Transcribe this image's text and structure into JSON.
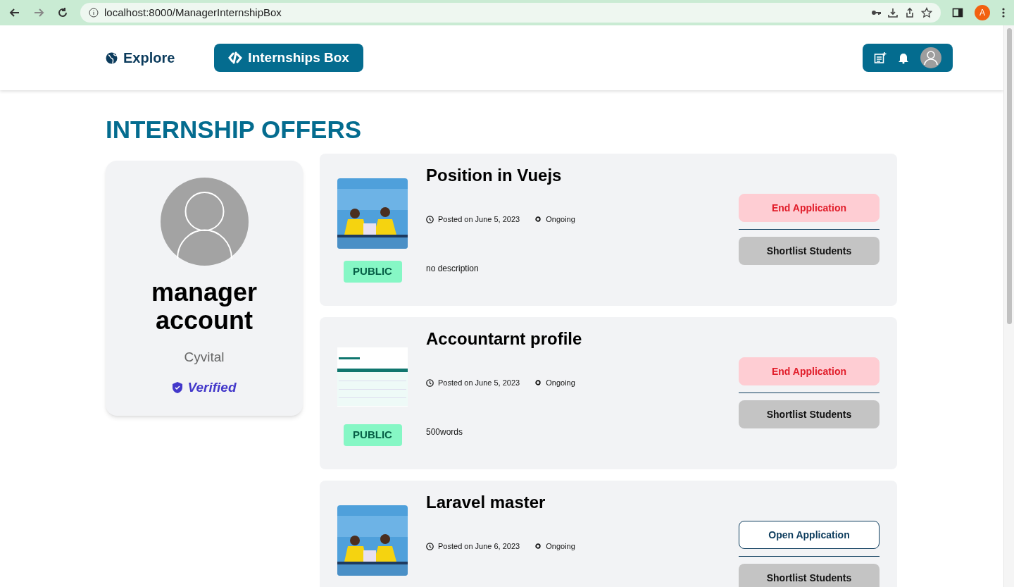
{
  "browser": {
    "url": "localhost:8000/ManagerInternshipBox",
    "profile_initial": "A"
  },
  "nav": {
    "explore": "Explore",
    "internships": "Internships Box"
  },
  "heading": "INTERNSHIP OFFERS",
  "profile": {
    "name": "manager account",
    "company": "Cyvital",
    "verified_label": "Verified"
  },
  "offers": [
    {
      "title": "Position in Vuejs",
      "posted": "Posted on June 5, 2023",
      "status": "Ongoing",
      "description": "no description",
      "visibility": "PUBLIC",
      "action": {
        "kind": "end",
        "label": "End Application"
      },
      "secondary": "Shortlist Students"
    },
    {
      "title": "Accountarnt profile",
      "posted": "Posted on June 5, 2023",
      "status": "Ongoing",
      "description": "500words",
      "visibility": "PUBLIC",
      "action": {
        "kind": "end",
        "label": "End Application"
      },
      "secondary": "Shortlist Students"
    },
    {
      "title": "Laravel master",
      "posted": "Posted on June 6, 2023",
      "status": "Ongoing",
      "action": {
        "kind": "open",
        "label": "Open Application"
      },
      "secondary": "Shortlist Students"
    }
  ]
}
